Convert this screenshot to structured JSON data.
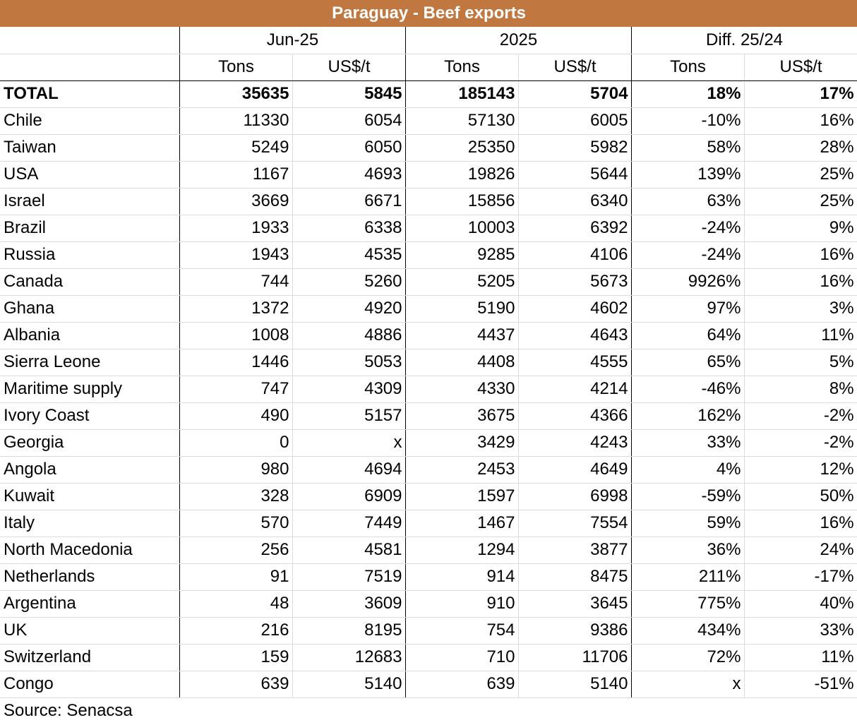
{
  "title": "Paraguay - Beef exports",
  "groups": [
    "Jun-25",
    "2025",
    "Diff. 25/24"
  ],
  "subheaders": [
    "Tons",
    "US$/t",
    "Tons",
    "US$/t",
    "Tons",
    "US$/t"
  ],
  "rows": [
    {
      "label": "TOTAL",
      "values": [
        "35635",
        "5845",
        "185143",
        "5704",
        "18%",
        "17%"
      ]
    },
    {
      "label": "Chile",
      "values": [
        "11330",
        "6054",
        "57130",
        "6005",
        "-10%",
        "16%"
      ]
    },
    {
      "label": "Taiwan",
      "values": [
        "5249",
        "6050",
        "25350",
        "5982",
        "58%",
        "28%"
      ]
    },
    {
      "label": "USA",
      "values": [
        "1167",
        "4693",
        "19826",
        "5644",
        "139%",
        "25%"
      ]
    },
    {
      "label": "Israel",
      "values": [
        "3669",
        "6671",
        "15856",
        "6340",
        "63%",
        "25%"
      ]
    },
    {
      "label": "Brazil",
      "values": [
        "1933",
        "6338",
        "10003",
        "6392",
        "-24%",
        "9%"
      ]
    },
    {
      "label": "Russia",
      "values": [
        "1943",
        "4535",
        "9285",
        "4106",
        "-24%",
        "16%"
      ]
    },
    {
      "label": "Canada",
      "values": [
        "744",
        "5260",
        "5205",
        "5673",
        "9926%",
        "16%"
      ]
    },
    {
      "label": "Ghana",
      "values": [
        "1372",
        "4920",
        "5190",
        "4602",
        "97%",
        "3%"
      ]
    },
    {
      "label": "Albania",
      "values": [
        "1008",
        "4886",
        "4437",
        "4643",
        "64%",
        "11%"
      ]
    },
    {
      "label": "Sierra Leone",
      "values": [
        "1446",
        "5053",
        "4408",
        "4555",
        "65%",
        "5%"
      ]
    },
    {
      "label": "Maritime supply",
      "values": [
        "747",
        "4309",
        "4330",
        "4214",
        "-46%",
        "8%"
      ]
    },
    {
      "label": "Ivory Coast",
      "values": [
        "490",
        "5157",
        "3675",
        "4366",
        "162%",
        "-2%"
      ]
    },
    {
      "label": "Georgia",
      "values": [
        "0",
        "x",
        "3429",
        "4243",
        "33%",
        "-2%"
      ]
    },
    {
      "label": "Angola",
      "values": [
        "980",
        "4694",
        "2453",
        "4649",
        "4%",
        "12%"
      ]
    },
    {
      "label": "Kuwait",
      "values": [
        "328",
        "6909",
        "1597",
        "6998",
        "-59%",
        "50%"
      ]
    },
    {
      "label": "Italy",
      "values": [
        "570",
        "7449",
        "1467",
        "7554",
        "59%",
        "16%"
      ]
    },
    {
      "label": "North Macedonia",
      "values": [
        "256",
        "4581",
        "1294",
        "3877",
        "36%",
        "24%"
      ]
    },
    {
      "label": "Netherlands",
      "values": [
        "91",
        "7519",
        "914",
        "8475",
        "211%",
        "-17%"
      ]
    },
    {
      "label": "Argentina",
      "values": [
        "48",
        "3609",
        "910",
        "3645",
        "775%",
        "40%"
      ]
    },
    {
      "label": "UK",
      "values": [
        "216",
        "8195",
        "754",
        "9386",
        "434%",
        "33%"
      ]
    },
    {
      "label": "Switzerland",
      "values": [
        "159",
        "12683",
        "710",
        "11706",
        "72%",
        "11%"
      ]
    },
    {
      "label": "Congo",
      "values": [
        "639",
        "5140",
        "639",
        "5140",
        "x",
        "-51%"
      ]
    }
  ],
  "source": "Source: Senacsa",
  "colors": {
    "title_bg": "#c07840",
    "title_text": "#ffffff"
  }
}
